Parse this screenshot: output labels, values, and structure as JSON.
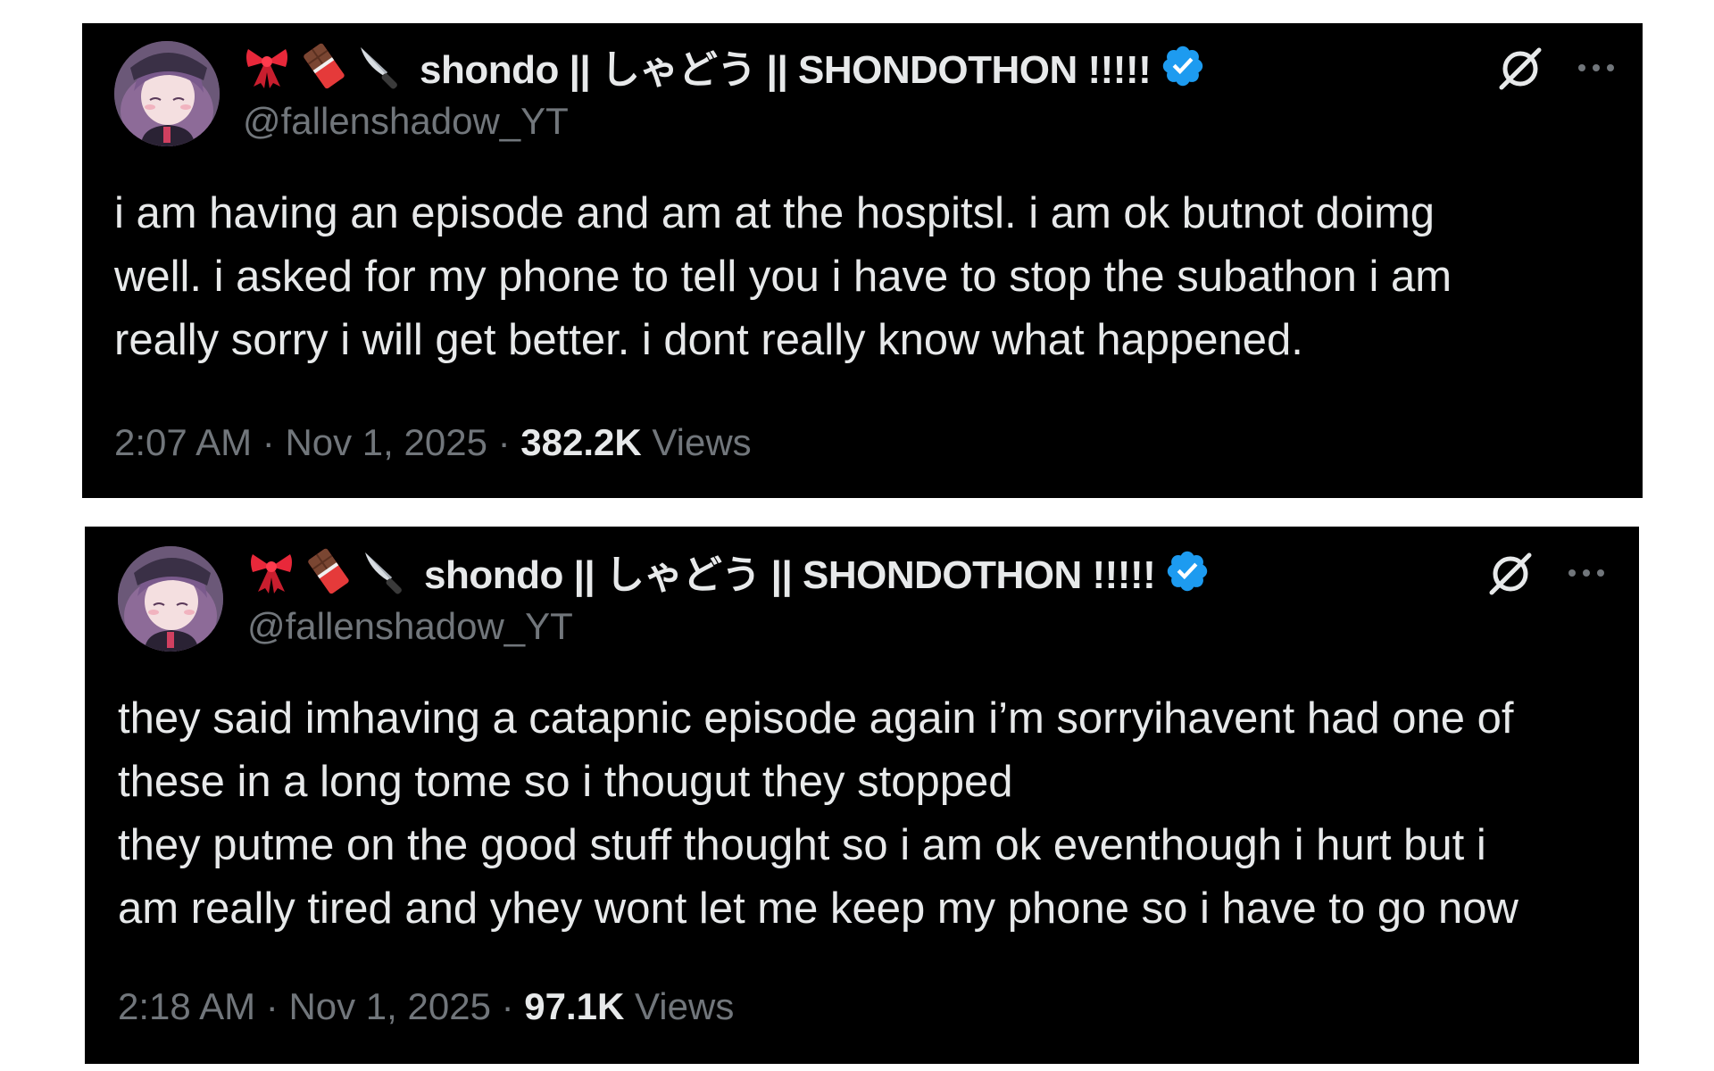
{
  "tweets": [
    {
      "display_name": "shondo || しゃどう || SHONDOTHON !!!!!",
      "name_emojis": [
        "ribbon-icon",
        "chocolate-bar-icon",
        "knife-icon"
      ],
      "handle": "@fallenshadow_YT",
      "text": "i am having an episode and am at the hospitsl. i am ok butnot doimg\nwell. i asked for my phone to tell you i have to stop the subathon i am\nreally sorry i will get better. i dont really know what happened.",
      "time": "2:07 AM",
      "date": "Nov 1, 2025",
      "separator": "·",
      "views_count": "382.2K",
      "views_label": "Views"
    },
    {
      "display_name": "shondo || しゃどう || SHONDOTHON !!!!!",
      "name_emojis": [
        "ribbon-icon",
        "chocolate-bar-icon",
        "knife-icon"
      ],
      "handle": "@fallenshadow_YT",
      "text": "they said imhaving a catapnic episode again i’m sorryihavent had one of\nthese in a long tome so i thougut they stopped\nthey putme on the good stuff thought so i am ok eventhough i hurt but i\nam really tired and yhey wont let me keep my phone so i have to go now",
      "time": "2:18 AM",
      "date": "Nov 1, 2025",
      "separator": "·",
      "views_count": "97.1K",
      "views_label": "Views"
    }
  ],
  "colors": {
    "card_background": "#000000",
    "primary_text": "#e7e9ea",
    "secondary_text": "#71767b",
    "verified_badge": "#1d9bf0"
  }
}
